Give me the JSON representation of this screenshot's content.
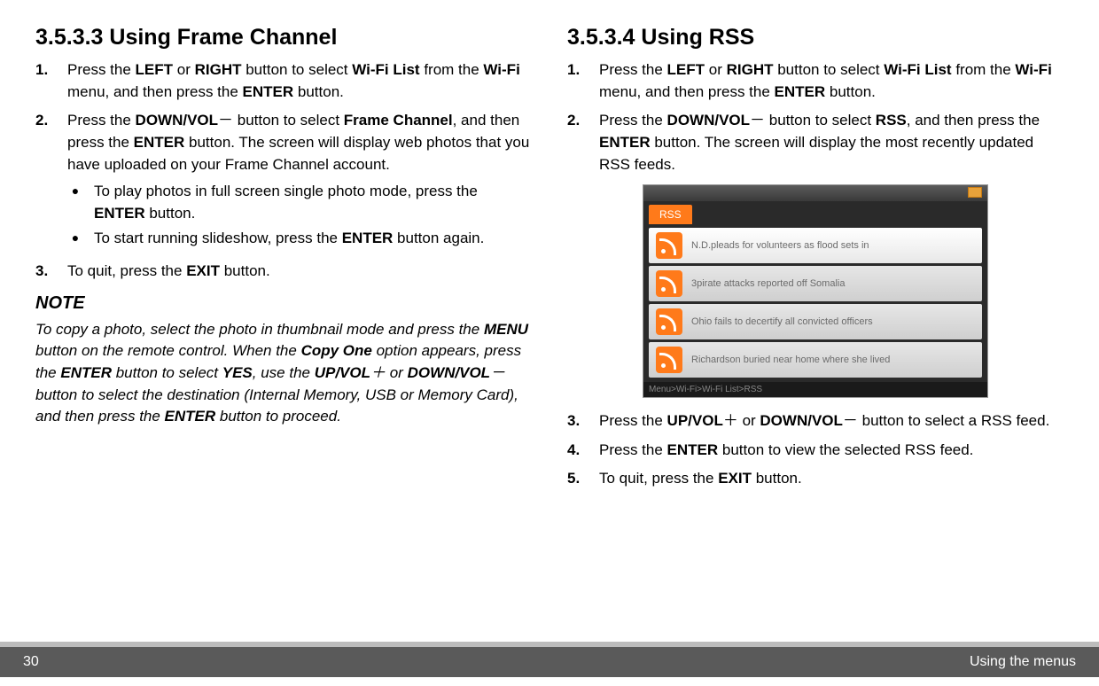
{
  "left": {
    "heading": "3.5.3.3 Using Frame Channel",
    "steps": [
      {
        "n": "1.",
        "html": "Press the <b>LEFT</b> or <b>RIGHT</b> button to select <b>Wi-Fi List</b> from the <b>Wi-Fi</b> menu, and then press the <b>ENTER</b> button."
      },
      {
        "n": "2.",
        "html": "Press the <b>DOWN/VOL</b><span class='plusminus'>－</span> button to select <b>Frame Channel</b>, and then press the <b>ENTER</b> button. The screen will display web photos that you have uploaded on your Frame Channel account.",
        "sub": [
          "To play photos in full screen single photo mode, press the <b>ENTER</b> button.",
          "To start running slideshow, press the <b>ENTER</b> button again."
        ]
      },
      {
        "n": "3.",
        "html": "To quit, press the <b>EXIT</b> button."
      }
    ],
    "noteTitle": "NOTE",
    "note": "To copy a photo, select the photo in thumbnail mode and press the <b>MENU</b> button on the remote control. When the <b>Copy One</b> option appears, press the <b>ENTER</b> button to select <b>YES</b>, use the <b>UP/VOL</b><span class='plusminus'>＋</span> or <b>DOWN/VOL</b><span class='plusminus'>－</span> button to select the destination (Internal Memory, USB or Memory Card), and then press the <b>ENTER</b> button to proceed."
  },
  "right": {
    "heading": "3.5.3.4 Using RSS",
    "stepsA": [
      {
        "n": "1.",
        "html": "Press the <b>LEFT</b> or <b>RIGHT</b> button to select <b>Wi-Fi List</b> from the <b>Wi-Fi</b> menu, and then press the <b>ENTER</b> button."
      },
      {
        "n": "2.",
        "html": "Press the <b>DOWN/VOL</b><span class='plusminus'>－</span> button to select <b>RSS</b>, and then press the <b>ENTER</b> button. The screen will display the most recently updated RSS feeds."
      }
    ],
    "rss": {
      "tab": "RSS",
      "items": [
        "N.D.pleads for volunteers as flood sets in",
        "3pirate attacks reported off Somalia",
        "Ohio fails to decertify all convicted officers",
        "Richardson buried near home where she lived"
      ],
      "crumb": "Menu>Wi-Fi>Wi-Fi List>RSS"
    },
    "stepsB": [
      {
        "n": "3.",
        "html": "Press the <b>UP/VOL</b><span class='plusminus'>＋</span> or <b>DOWN/VOL</b><span class='plusminus'>－</span> button to select a RSS feed."
      },
      {
        "n": "4.",
        "html": "Press the <b>ENTER</b> button to view the selected RSS feed."
      },
      {
        "n": "5.",
        "html": "To quit, press the <b>EXIT</b> button."
      }
    ]
  },
  "footer": {
    "page": "30",
    "section": "Using the menus"
  }
}
